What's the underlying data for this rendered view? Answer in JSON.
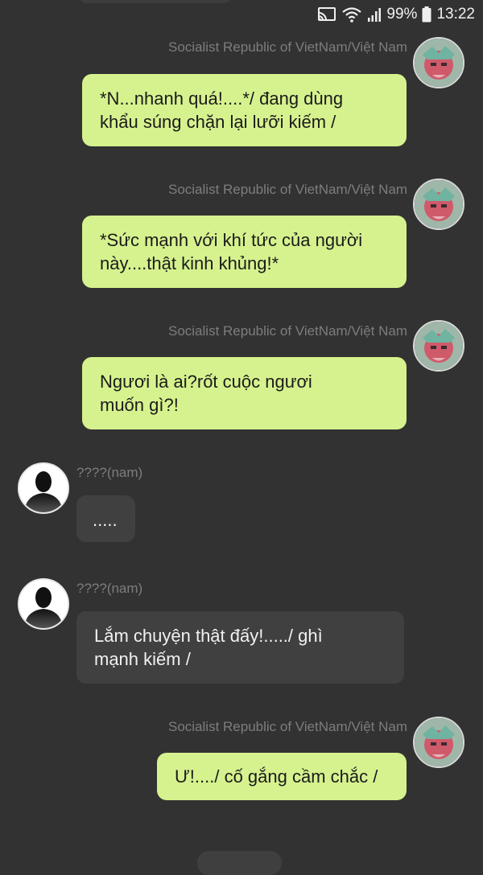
{
  "status_bar": {
    "battery": "99%",
    "time": "13:22"
  },
  "me_name": "Socialist Republic of VietNam/Việt  Nam",
  "them_name": "????(nam)",
  "messages": [
    {
      "from": "me",
      "text_lines": [
        "*N...nhanh quá!....*/ đang dùng",
        "khẩu súng chặn lại lưỡi kiếm /"
      ]
    },
    {
      "from": "me",
      "text_lines": [
        "*Sức mạnh với khí tức của người",
        "này....thật kinh khủng!*"
      ]
    },
    {
      "from": "me",
      "text_lines": [
        "Ngươi là ai?rốt cuộc ngươi",
        "muốn gì?!"
      ]
    },
    {
      "from": "them",
      "text_lines": [
        "....."
      ]
    },
    {
      "from": "them",
      "text_lines": [
        "Lắm chuyện thật đấy!...../ ghì",
        "mạnh kiếm /"
      ]
    },
    {
      "from": "me",
      "text_lines": [
        "Ư!..../ cố gắng cầm chắc /"
      ]
    }
  ]
}
